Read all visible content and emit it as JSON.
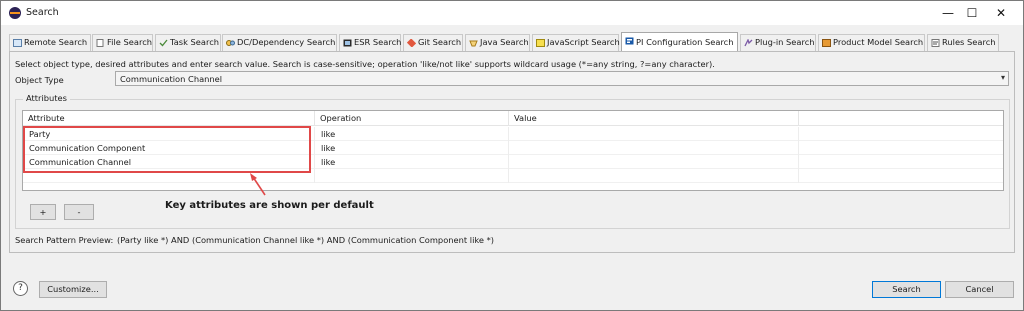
{
  "window": {
    "title": "Search",
    "controls": {
      "minimize": "—",
      "maximize": "☐",
      "close": "✕"
    }
  },
  "tabs": [
    {
      "label": "Remote Search",
      "icon": "remote-search-icon"
    },
    {
      "label": "File Search",
      "icon": "file-search-icon"
    },
    {
      "label": "Task Search",
      "icon": "task-search-icon"
    },
    {
      "label": "DC/Dependency Search",
      "icon": "dc-dependency-icon"
    },
    {
      "label": "ESR Search",
      "icon": "esr-search-icon"
    },
    {
      "label": "Git Search",
      "icon": "git-search-icon"
    },
    {
      "label": "Java Search",
      "icon": "java-search-icon"
    },
    {
      "label": "JavaScript Search",
      "icon": "javascript-search-icon"
    },
    {
      "label": "PI Configuration Search",
      "icon": "pi-configuration-icon",
      "active": true
    },
    {
      "label": "Plug-in Search",
      "icon": "plugin-search-icon"
    },
    {
      "label": "Product Model Search",
      "icon": "product-model-icon"
    },
    {
      "label": "Rules Search",
      "icon": "rules-search-icon"
    }
  ],
  "panel": {
    "help_text": "Select object type, desired attributes and enter search value. Search is case-sensitive; operation 'like/not like' supports wildcard usage (*=any string, ?=any character).",
    "object_type_label": "Object Type",
    "object_type_value": "Communication Channel",
    "attributes_group_label": "Attributes",
    "table": {
      "headers": [
        "Attribute",
        "Operation",
        "Value",
        ""
      ],
      "rows": [
        {
          "attribute": "Party",
          "operation": "like",
          "value": ""
        },
        {
          "attribute": "Communication Component",
          "operation": "like",
          "value": ""
        },
        {
          "attribute": "Communication Channel",
          "operation": "like",
          "value": ""
        }
      ]
    },
    "add_label": "+",
    "remove_label": "-",
    "annotation": "Key attributes are shown per default",
    "preview_label": "Search Pattern Preview:",
    "preview_value": "(Party like *) AND (Communication Channel like *) AND (Communication Component like *)"
  },
  "footer": {
    "help_icon": "?",
    "customize_label": "Customize...",
    "search_label": "Search",
    "cancel_label": "Cancel"
  },
  "colors": {
    "highlight": "#e04848",
    "focus_button_border": "#0078d7"
  }
}
